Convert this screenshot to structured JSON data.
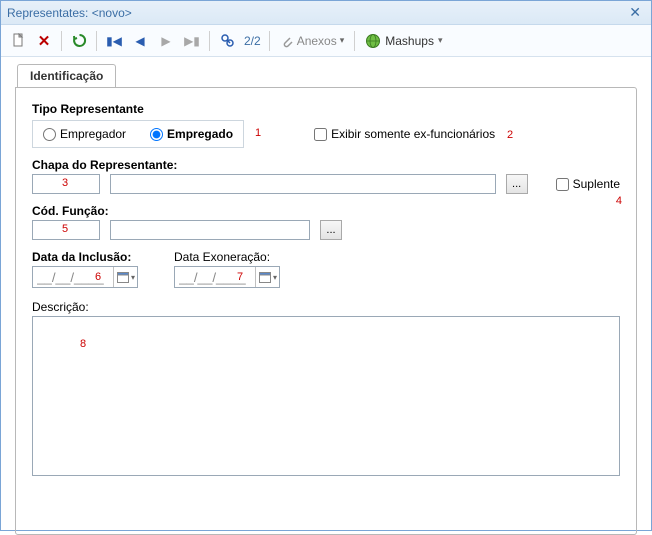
{
  "window": {
    "title": "Representates: <novo>"
  },
  "toolbar": {
    "pagecount": "2/2",
    "anexos": "Anexos",
    "mashups": "Mashups"
  },
  "tabs": {
    "identificacao": "Identificação"
  },
  "form": {
    "tipo_label": "Tipo Representante",
    "radio_empregador": "Empregador",
    "radio_empregado": "Empregado",
    "exibir_ex": "Exibir somente ex-funcionários",
    "chapa_label": "Chapa do Representante:",
    "suplente": "Suplente",
    "cod_funcao_label": "Cód. Função:",
    "data_inclusao_label": "Data da Inclusão:",
    "data_exoneracao_label": "Data Exoneração:",
    "date_mask": "__/__/____",
    "descricao_label": "Descrição:",
    "lookup": "..."
  },
  "annotations": {
    "a1": "1",
    "a2": "2",
    "a3": "3",
    "a4": "4",
    "a5": "5",
    "a6": "6",
    "a7": "7",
    "a8": "8"
  }
}
